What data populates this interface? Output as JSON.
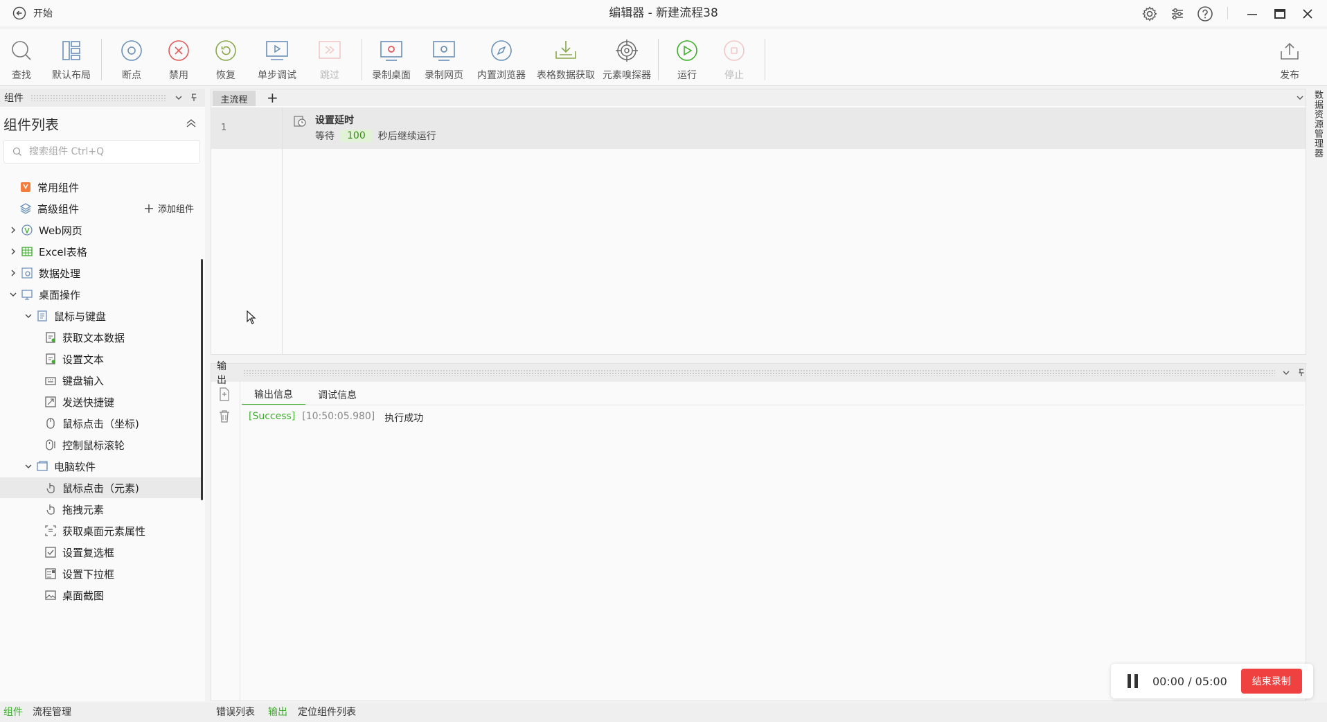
{
  "titlebar": {
    "back_label": "开始",
    "window_title": "编辑器 - 新建流程38"
  },
  "ribbon": {
    "buttons": [
      {
        "label": "查找",
        "icon": "search-icon"
      },
      {
        "label": "默认布局",
        "icon": "layout-icon"
      },
      {
        "label": "断点",
        "icon": "breakpoint-icon"
      },
      {
        "label": "禁用",
        "icon": "disable-icon"
      },
      {
        "label": "恢复",
        "icon": "restore-icon"
      },
      {
        "label": "单步调试",
        "icon": "step-debug-icon"
      },
      {
        "label": "跳过",
        "icon": "skip-icon"
      },
      {
        "label": "录制桌面",
        "icon": "record-desktop-icon"
      },
      {
        "label": "录制网页",
        "icon": "record-web-icon"
      },
      {
        "label": "内置浏览器",
        "icon": "browser-icon"
      },
      {
        "label": "表格数据获取",
        "icon": "table-download-icon"
      },
      {
        "label": "元素嗅探器",
        "icon": "target-icon"
      },
      {
        "label": "运行",
        "icon": "run-icon"
      },
      {
        "label": "停止",
        "icon": "stop-icon"
      },
      {
        "label": "发布",
        "icon": "publish-icon"
      }
    ]
  },
  "left_panel": {
    "header": "组件",
    "list_title": "组件列表",
    "search_placeholder": "搜索组件 Ctrl+Q",
    "add_component_label": "添加组件",
    "tree": [
      {
        "label": "常用组件"
      },
      {
        "label": "高级组件"
      },
      {
        "label": "Web网页"
      },
      {
        "label": "Excel表格"
      },
      {
        "label": "数据处理"
      },
      {
        "label": "桌面操作"
      },
      {
        "label": "鼠标与键盘"
      },
      {
        "label": "获取文本数据"
      },
      {
        "label": "设置文本"
      },
      {
        "label": "键盘输入"
      },
      {
        "label": "发送快捷键"
      },
      {
        "label": "鼠标点击（坐标)"
      },
      {
        "label": "控制鼠标滚轮"
      },
      {
        "label": "电脑软件"
      },
      {
        "label": "鼠标点击（元素)"
      },
      {
        "label": "拖拽元素"
      },
      {
        "label": "获取桌面元素属性"
      },
      {
        "label": "设置复选框"
      },
      {
        "label": "设置下拉框"
      },
      {
        "label": "桌面截图"
      }
    ]
  },
  "editor": {
    "tab_main": "主流程",
    "tab_add": "+",
    "step": {
      "line_number": "1",
      "title": "设置延时",
      "desc_prefix": "等待",
      "value": "100",
      "desc_suffix": "秒后继续运行"
    }
  },
  "right_tab": {
    "label": "数据资源管理器"
  },
  "output": {
    "header": "输出",
    "tabs": [
      "输出信息",
      "调试信息"
    ],
    "log": {
      "status": "[Success]",
      "time": "[10:50:05.980]",
      "message": "执行成功"
    }
  },
  "recording": {
    "time": "00:00 / 05:00",
    "stop_label": "结束录制",
    "stop_color": "#f04141"
  },
  "bottom_tabs": {
    "left": [
      "组件",
      "流程管理"
    ],
    "right": [
      "错误列表",
      "输出",
      "定位组件列表"
    ]
  },
  "colors": {
    "accent_green": "#3dad2b"
  }
}
